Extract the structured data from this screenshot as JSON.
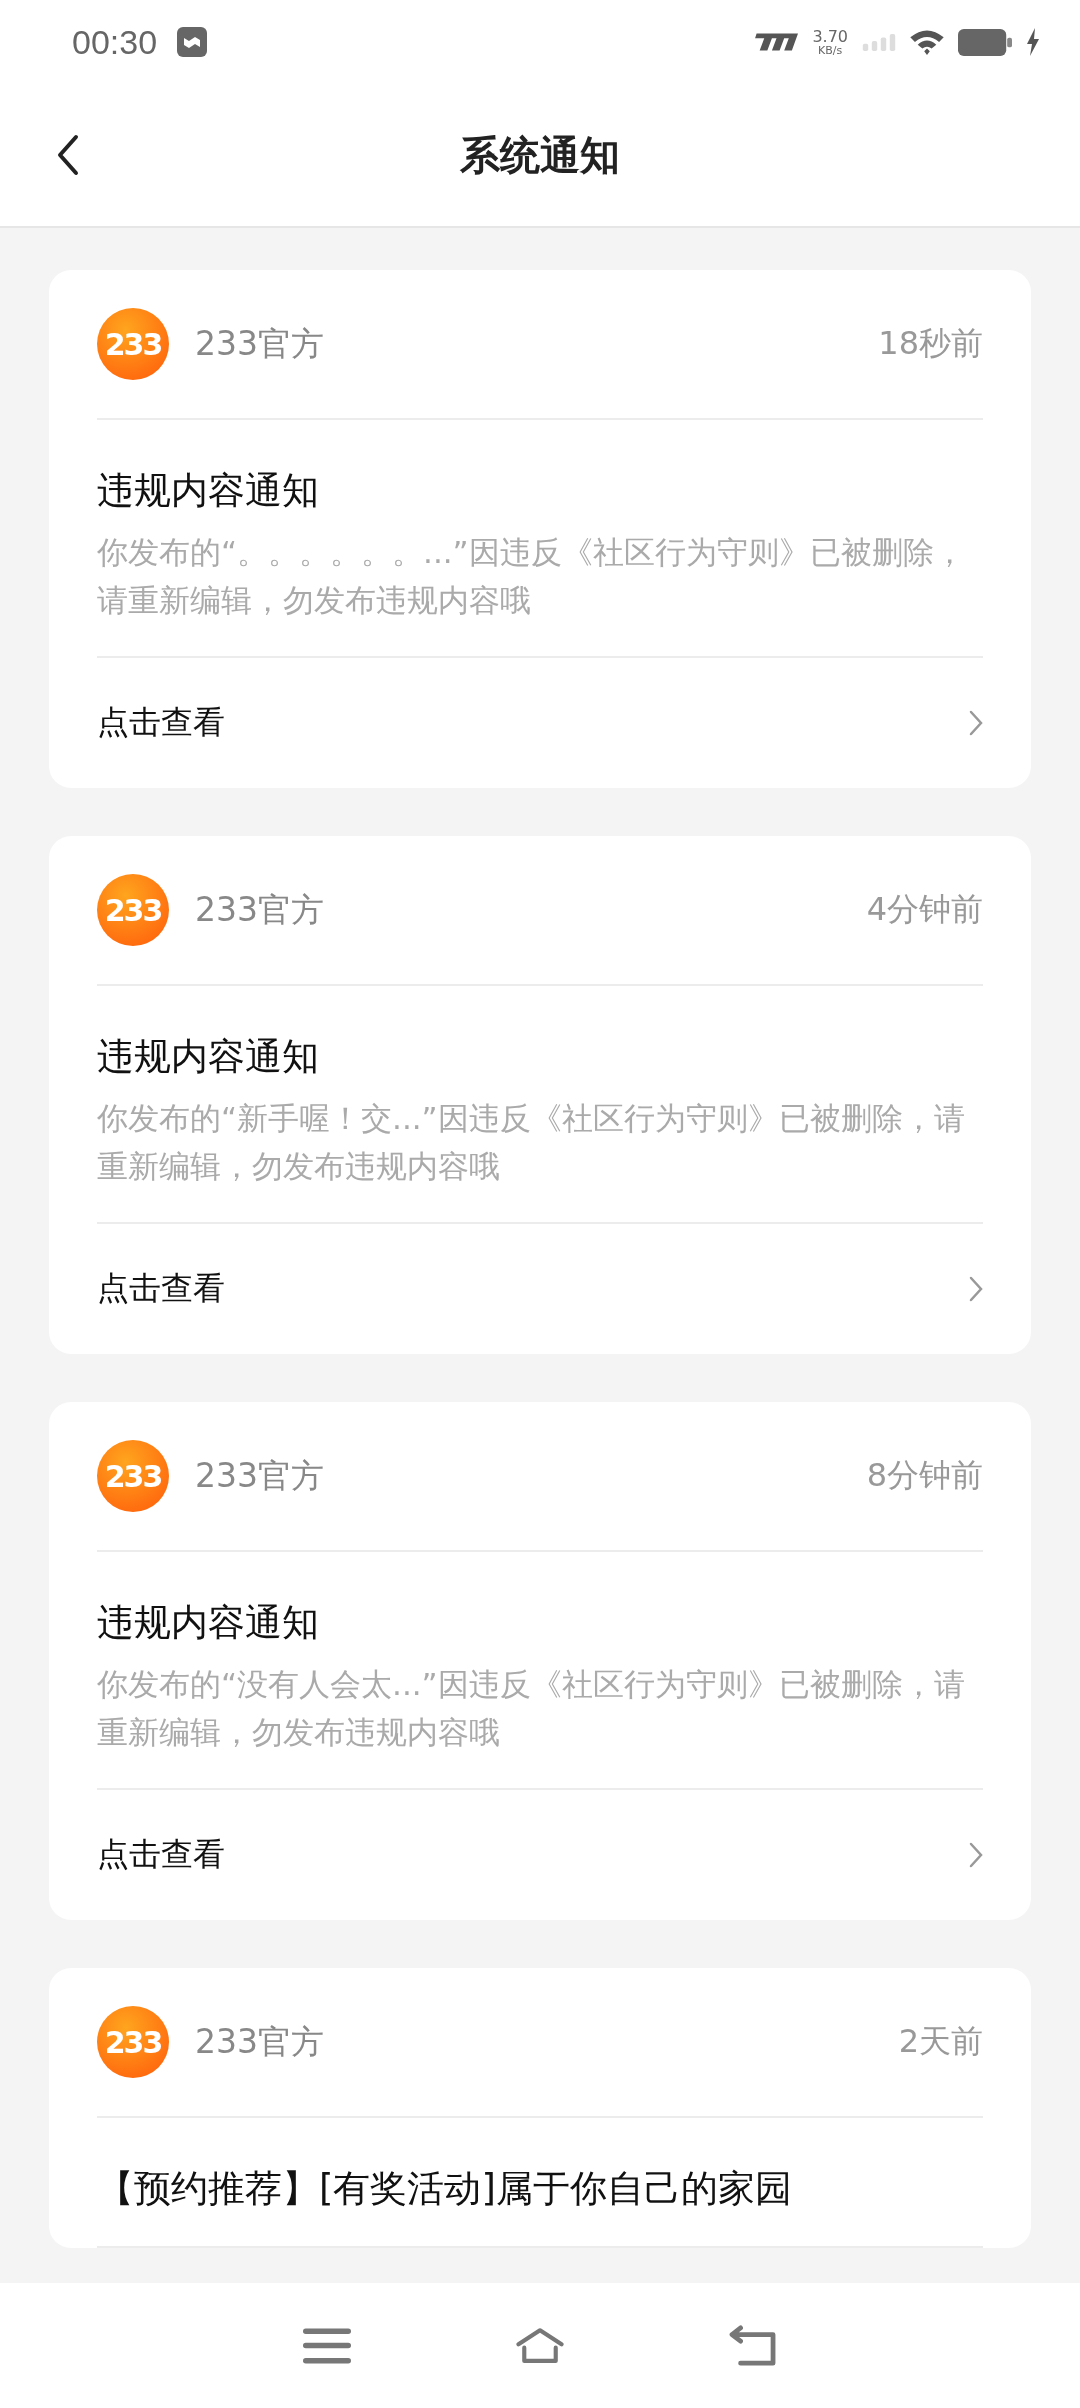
{
  "status_bar": {
    "time": "00:30",
    "net_speed": "3.70",
    "net_unit": "KB/s"
  },
  "header": {
    "title": "系统通知"
  },
  "notifications": [
    {
      "sender": "233官方",
      "logo_text": "233",
      "time": "18秒前",
      "title": "违规内容通知",
      "body": "你发布的“。。。。。。...”因违反《社区行为守则》已被删除，请重新编辑，勿发布违规内容哦",
      "link": "点击查看"
    },
    {
      "sender": "233官方",
      "logo_text": "233",
      "time": "4分钟前",
      "title": "违规内容通知",
      "body": "你发布的“新手喔！交...”因违反《社区行为守则》已被删除，请重新编辑，勿发布违规内容哦",
      "link": "点击查看"
    },
    {
      "sender": "233官方",
      "logo_text": "233",
      "time": "8分钟前",
      "title": "违规内容通知",
      "body": "你发布的“没有人会太...”因违反《社区行为守则》已被删除，请重新编辑，勿发布违规内容哦",
      "link": "点击查看"
    },
    {
      "sender": "233官方",
      "logo_text": "233",
      "time": "2天前",
      "title": "【预约推荐】[有奖活动]属于你自己的家园"
    }
  ]
}
